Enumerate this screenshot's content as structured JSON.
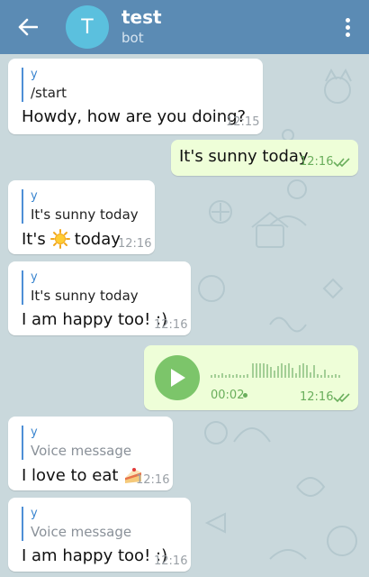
{
  "header": {
    "avatar_letter": "T",
    "title": "test",
    "subtitle": "bot",
    "bar_color": "#5b8bb4",
    "avatar_color": "#5bc0de"
  },
  "icons": [
    "arrow-left-icon",
    "more-vertical-icon",
    "play-icon",
    "double-check-icon",
    "sun-icon",
    "cake-icon"
  ],
  "messages": [
    {
      "direction": "in",
      "reply_name": "y",
      "reply_text": "/start",
      "text": "Howdy, how are you doing?",
      "time": "12:15"
    },
    {
      "direction": "out",
      "text": "It's sunny today",
      "time": "12:16"
    },
    {
      "direction": "in",
      "reply_name": "y",
      "reply_text": "It's sunny today",
      "text_before": "It's",
      "emoji": "sun",
      "text_after": "today",
      "time": "12:16"
    },
    {
      "direction": "in",
      "reply_name": "y",
      "reply_text": "It's sunny today",
      "text": "I am happy too! :)",
      "time": "12:16"
    },
    {
      "direction": "out",
      "type": "voice",
      "duration": "00:02",
      "time": "12:16"
    },
    {
      "direction": "in",
      "reply_name": "y",
      "reply_text": "Voice message",
      "text": "I love to eat",
      "emoji": "cake",
      "time": "12:16"
    },
    {
      "direction": "in",
      "reply_name": "y",
      "reply_text": "Voice message",
      "text": "I am happy too! :)",
      "time": "12:16"
    }
  ]
}
